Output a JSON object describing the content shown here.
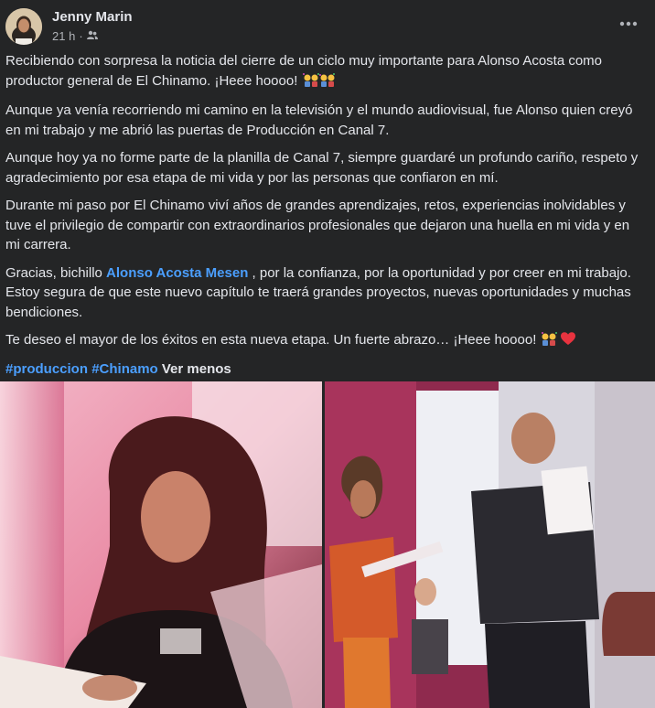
{
  "post": {
    "author": "Jenny Marin",
    "time": "21 h",
    "separator": "·",
    "privacy_icon": "friends-icon",
    "more_icon": "more-horizontal-icon",
    "paragraphs": {
      "p1": "Recibiendo con sorpresa la noticia del cierre de un ciclo muy importante para Alonso Acosta como productor general de El Chinamo. ¡Heee hoooo!",
      "p2": "Aunque ya venía recorriendo mi camino en la televisión y el mundo audiovisual, fue Alonso quien creyó en mi trabajo y me abrió las puertas de Producción en Canal 7.",
      "p3": "Aunque hoy ya no forme parte de la planilla de Canal 7, siempre guardaré un profundo cariño, respeto y agradecimiento por esa etapa de mi vida y por las personas que confiaron en mí.",
      "p4": "Durante mi paso por El Chinamo viví años de grandes aprendizajes, retos, experiencias inolvidables y tuve el privilegio de compartir con extraordinarios profesionales que dejaron una huella en mi vida y en mi carrera.",
      "p5_before": "Gracias, bichillo",
      "p5_mention": "Alonso Acosta Mesen",
      "p5_after": ", por la confianza, por la oportunidad y por creer en mi trabajo. Estoy segura de que este nuevo capítulo te traerá grandes proyectos, nuevas oportunidades y muchas bendiciones.",
      "p6": "Te deseo el mayor de los éxitos en esta nueva etapa. Un fuerte abrazo… ¡Heee hoooo!"
    },
    "hashtags": [
      "#produccion",
      "#Chinamo"
    ],
    "see_less": "Ver menos",
    "emojis": [
      "confetti-people-emoji",
      "red-heart-emoji"
    ],
    "colors": {
      "background": "#242526",
      "text": "#e4e6eb",
      "secondary_text": "#b0b3b8",
      "link": "#4b9fff"
    }
  }
}
